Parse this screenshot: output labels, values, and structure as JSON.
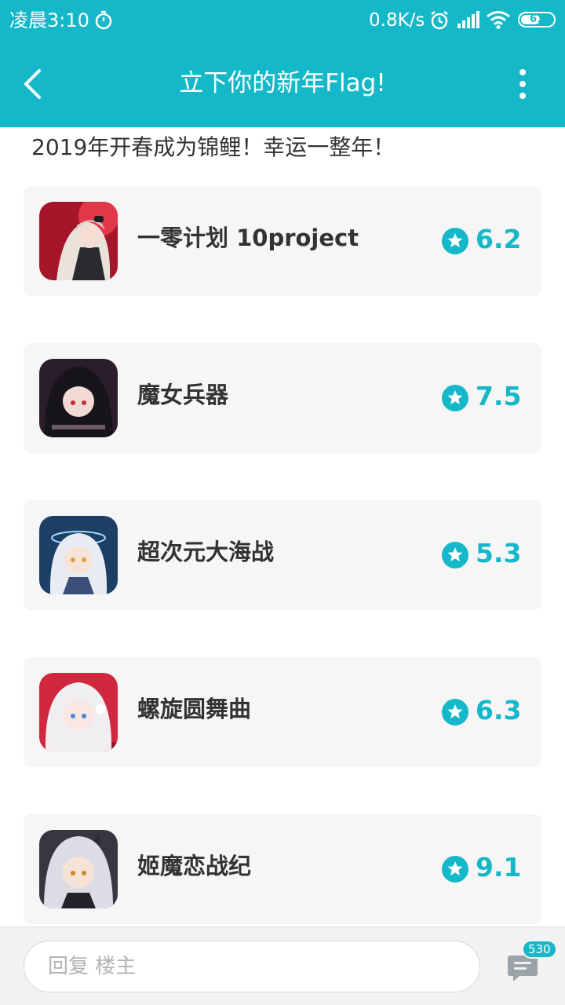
{
  "status_bar": {
    "time": "凌晨3:10",
    "net_speed": "0.8K/s",
    "battery_level": "61",
    "battery_fraction": 0.61,
    "icons": [
      "timer-icon",
      "alarm-icon",
      "signal-icon",
      "wifi-icon",
      "battery-icon"
    ]
  },
  "header": {
    "title": "立下你的新年Flag!",
    "back_icon": "back-arrow-icon",
    "more_icon": "more-vertical-icon"
  },
  "post": {
    "text": "2019年开春成为锦鲤！幸运一整年！"
  },
  "games": [
    {
      "name": "一零计划 10project",
      "score": "6.2"
    },
    {
      "name": "魔女兵器",
      "score": "7.5"
    },
    {
      "name": "超次元大海战",
      "score": "5.3"
    },
    {
      "name": "螺旋圆舞曲",
      "score": "6.3"
    },
    {
      "name": "姬魔恋战纪",
      "score": "9.1"
    }
  ],
  "bottom_bar": {
    "reply_placeholder": "回复  楼主",
    "comment_count": "530"
  },
  "colors": {
    "accent": "#14b8c8",
    "card_bg": "#f6f6f6",
    "text": "#333333"
  }
}
